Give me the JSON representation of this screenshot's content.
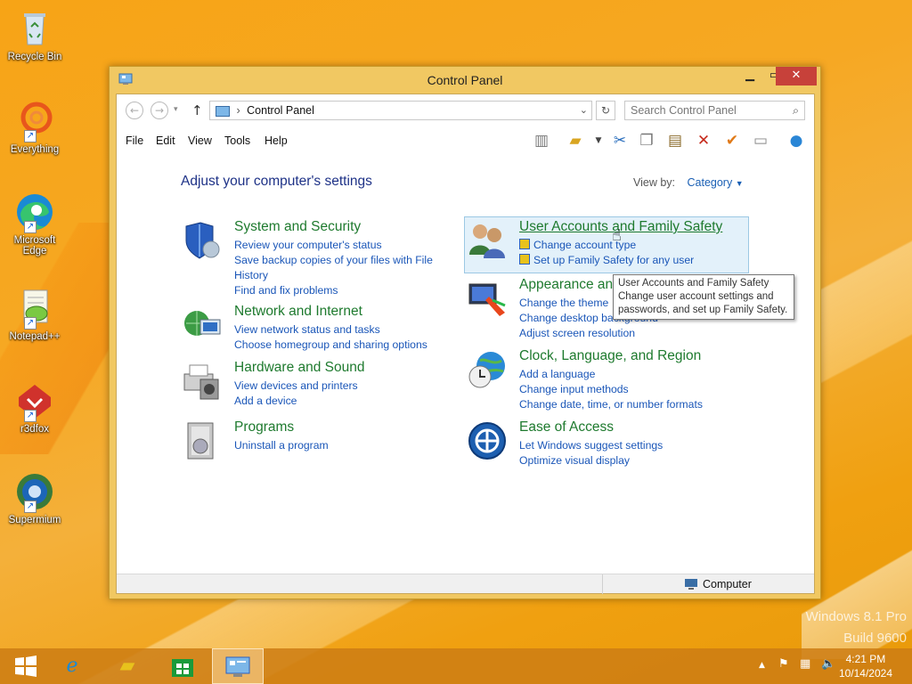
{
  "desktop": {
    "icons": [
      {
        "label": "Recycle Bin",
        "icon": "recycle-bin-icon"
      },
      {
        "label": "Everything",
        "icon": "everything-search-icon"
      },
      {
        "label": "Microsoft Edge",
        "icon": "edge-icon"
      },
      {
        "label": "Notepad++",
        "icon": "notepad-plus-plus-icon"
      },
      {
        "label": "r3dfox",
        "icon": "r3dfox-icon"
      },
      {
        "label": "Supermium",
        "icon": "supermium-icon"
      }
    ],
    "watermark_line1": "Windows 8.1 Pro",
    "watermark_line2": "Build 9600"
  },
  "window": {
    "title": "Control Panel",
    "address": "Control Panel",
    "search_placeholder": "Search Control Panel",
    "menu": [
      "File",
      "Edit",
      "View",
      "Tools",
      "Help"
    ],
    "heading": "Adjust your computer's settings",
    "view_by_label": "View by:",
    "view_by_value": "Category",
    "status_text": "Computer"
  },
  "categories": [
    {
      "title": "System and Security",
      "links": [
        "Review your computer's status",
        "Save backup copies of your files with File",
        "History",
        "Find and fix problems"
      ]
    },
    {
      "title": "Network and Internet",
      "links": [
        "View network status and tasks",
        "Choose homegroup and sharing options"
      ]
    },
    {
      "title": "Hardware and Sound",
      "links": [
        "View devices and printers",
        "Add a device"
      ]
    },
    {
      "title": "Programs",
      "links": [
        "Uninstall a program"
      ]
    },
    {
      "title": "User Accounts and Family Safety",
      "links": [
        "Change account type",
        "Set up Family Safety for any user"
      ]
    },
    {
      "title": "Appearance and Personalization",
      "links": [
        "Change the theme",
        "Change desktop background",
        "Adjust screen resolution"
      ]
    },
    {
      "title": "Clock, Language, and Region",
      "links": [
        "Add a language",
        "Change input methods",
        "Change date, time, or number formats"
      ]
    },
    {
      "title": "Ease of Access",
      "links": [
        "Let Windows suggest settings",
        "Optimize visual display"
      ]
    }
  ],
  "tooltip": {
    "line1": "User Accounts and Family Safety",
    "line2": "Change user account settings and",
    "line3": "passwords, and set up Family Safety."
  },
  "taskbar": {
    "time": "4:21 PM",
    "date": "10/14/2024"
  }
}
